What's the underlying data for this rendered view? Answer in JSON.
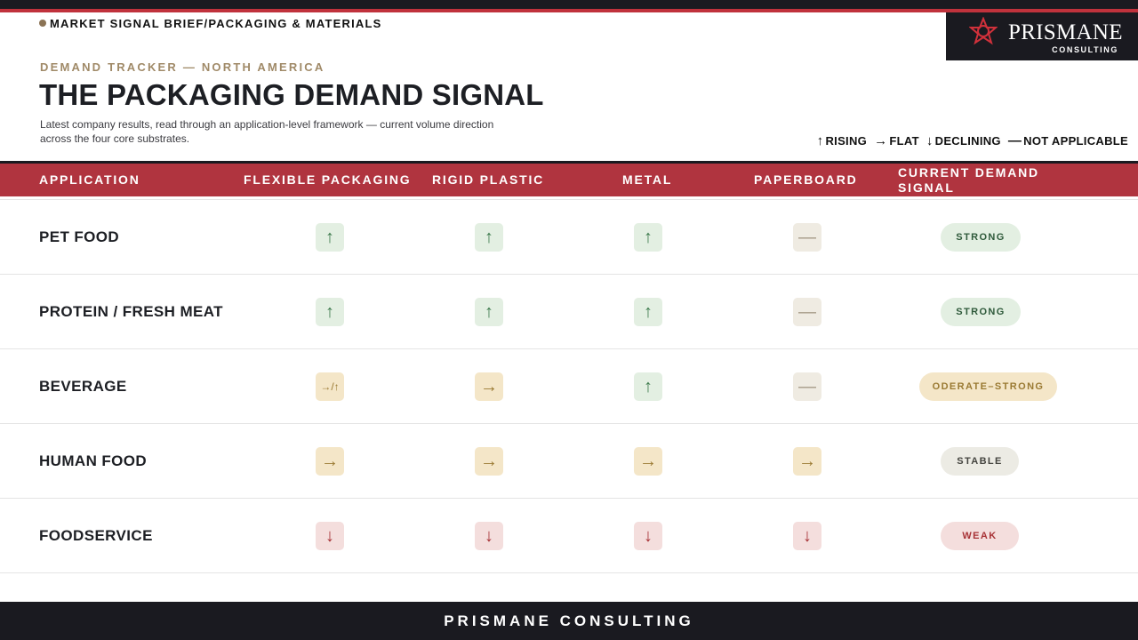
{
  "brief_label": "MARKET SIGNAL BRIEF/PACKAGING & MATERIALS",
  "logo": {
    "name": "PRISMANE",
    "sub": "CONSULTING"
  },
  "kicker": "DEMAND TRACKER — NORTH AMERICA",
  "title": "THE PACKAGING DEMAND SIGNAL",
  "subtitle": "Latest company results, read through an application-level framework — current volume direction across the four core substrates.",
  "legend": [
    {
      "symbol": "↑",
      "label": "RISING"
    },
    {
      "symbol": "→",
      "label": "FLAT"
    },
    {
      "symbol": "↓",
      "label": "DECLINING"
    },
    {
      "symbol": "—",
      "label": "NOT APPLICABLE"
    }
  ],
  "columns": {
    "application": "APPLICATION",
    "flexible": "FLEXIBLE PACKAGING",
    "rigid": "RIGID PLASTIC",
    "metal": "METAL",
    "paperboard": "PAPERBOARD",
    "signal": "CURRENT DEMAND SIGNAL"
  },
  "rows": [
    {
      "label": "PET FOOD",
      "cells": [
        {
          "symbol": "↑",
          "kind": "up"
        },
        {
          "symbol": "↑",
          "kind": "up"
        },
        {
          "symbol": "↑",
          "kind": "up"
        },
        {
          "symbol": "—",
          "kind": "na"
        }
      ],
      "signal": {
        "text": "STRONG",
        "kind": "strong"
      }
    },
    {
      "label": "PROTEIN / FRESH MEAT",
      "cells": [
        {
          "symbol": "↑",
          "kind": "up"
        },
        {
          "symbol": "↑",
          "kind": "up"
        },
        {
          "symbol": "↑",
          "kind": "up"
        },
        {
          "symbol": "—",
          "kind": "na"
        }
      ],
      "signal": {
        "text": "STRONG",
        "kind": "strong"
      }
    },
    {
      "label": "BEVERAGE",
      "cells": [
        {
          "symbol": "→/↑",
          "kind": "flat"
        },
        {
          "symbol": "→",
          "kind": "flat"
        },
        {
          "symbol": "↑",
          "kind": "up"
        },
        {
          "symbol": "—",
          "kind": "na"
        }
      ],
      "signal": {
        "text": "ODERATE–STRONG",
        "kind": "moderate"
      }
    },
    {
      "label": "HUMAN FOOD",
      "cells": [
        {
          "symbol": "→",
          "kind": "flat"
        },
        {
          "symbol": "→",
          "kind": "flat"
        },
        {
          "symbol": "→",
          "kind": "flat"
        },
        {
          "symbol": "→",
          "kind": "flat"
        }
      ],
      "signal": {
        "text": "STABLE",
        "kind": "stable"
      }
    },
    {
      "label": "FOODSERVICE",
      "cells": [
        {
          "symbol": "↓",
          "kind": "down"
        },
        {
          "symbol": "↓",
          "kind": "down"
        },
        {
          "symbol": "↓",
          "kind": "down"
        },
        {
          "symbol": "↓",
          "kind": "down"
        }
      ],
      "signal": {
        "text": "WEAK",
        "kind": "weak"
      }
    }
  ],
  "footer": "PRISMANE CONSULTING",
  "colors": {
    "brand_dark": "#1a1a20",
    "accent_red": "#b0343f",
    "kicker_gold": "#a08a68",
    "rising_green": "#3d7a4c",
    "flat_amber": "#9a7a33",
    "declining_red": "#a73236"
  }
}
